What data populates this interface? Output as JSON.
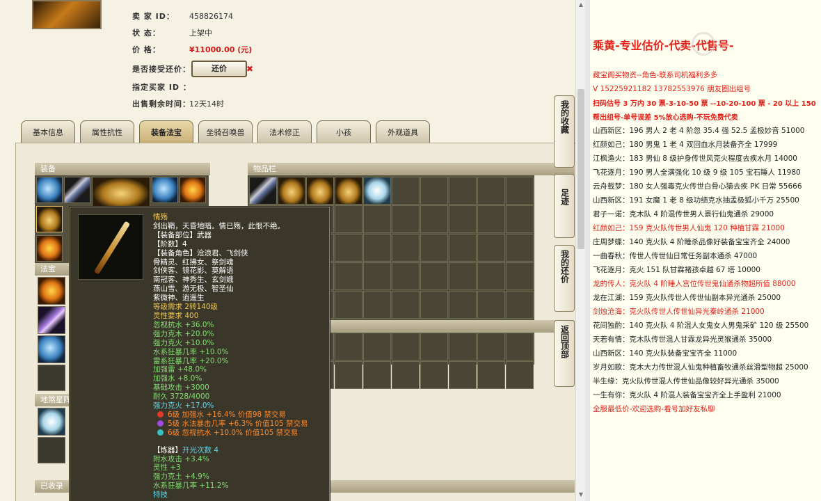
{
  "listing": {
    "seller_label": "卖 家 ID：",
    "seller_id": "458826174",
    "status_label": "状 态：",
    "status_value": "上架中",
    "price_label": "价 格：",
    "price_value": "¥11000.00 (元)",
    "counter_label": "是否接受还价：",
    "counter_button": "还价",
    "counter_close": "✖",
    "buyer_label": "指定买家 ID ：",
    "buyer_value": "",
    "remaining_label": "出售剩余时间：",
    "remaining_value": "12天14时"
  },
  "tabs": [
    "基本信息",
    "属性抗性",
    "装备法宝",
    "坐骑召唤兽",
    "法术修正",
    "小孩",
    "外观道具"
  ],
  "active_tab": 2,
  "panels": {
    "equip": "装备",
    "fabao": "法宝",
    "items": "物品栏",
    "lower_left": "地煞星阵",
    "collected": "已收录"
  },
  "side_buttons": [
    "我的收藏",
    "足迹",
    "我的还价",
    "返回顶部"
  ],
  "tooltip": {
    "name": "情殇",
    "desc": "剑出鞘，天昏地暗。情已殇，此恨不绝。",
    "slot": "【装备部位】武器",
    "tier": "【阶数】4",
    "roles_label": "【装备角色】",
    "roles": [
      "沧浪君、飞剑侠",
      "骨精灵、红拂女、祭剑魂",
      "剑侠客、镜花影、莫解语",
      "南冠客、神秀生、玄剑娥",
      "燕山雪、游无极、智圣仙",
      "紫微神、逍遥生"
    ],
    "level_req": "等级需求 2转140级",
    "spirit_req": "灵性要求 400",
    "stats": [
      "忽视抗水 +36.0%",
      "强力克木 +20.0%",
      "强力克火 +10.0%",
      "水系狂暴几率 +10.0%",
      "雷系狂暴几率 +20.0%",
      "加强雷 +48.0%",
      "加强水 +8.0%",
      "基础攻击 +3000",
      "耐久 3728/4000"
    ],
    "bonus": "强力克火 +17.0%",
    "gems": [
      {
        "text": "6级 加强水 +16.4% 价值98 禁交易",
        "color": "#e23a2a"
      },
      {
        "text": "5级 水法暴击几率 +6.3% 价值105 禁交易",
        "color": "#a04ae0"
      },
      {
        "text": "6级 忽视抗水 +10.0% 价值105 禁交易",
        "color": "#3ac0c0"
      }
    ],
    "refine_label": "【炼器】",
    "refine_count": "开光次数 4",
    "refine_stats": [
      "附水攻击 +3.4%",
      "灵性 +3",
      "强力克土 +4.9%",
      "水系狂暴几率 +11.2%"
    ],
    "last_line": "特技"
  },
  "notes": {
    "title": "乘黄-专业估价-代卖-代售号-",
    "watermark": "",
    "lines": [
      {
        "t": "藏宝阁买物资--角色-联系司机福利多多",
        "c": "note-red"
      },
      {
        "t": "V 15225921182   13782553976 朋友圈出组号",
        "c": "note-red"
      },
      {
        "t": "扫码估号 3 万内 30 票-3-10-50 票 --10-20-100 票 - 20 以上 150",
        "c": "note-bold-red"
      },
      {
        "t": "帮出组号-单号误差 5%放心选购-不玩免费代卖",
        "c": "note-bold-red"
      },
      {
        "t": "山西新区：196 男人 2 老 4 阶忽 35.4 强 52.5 孟极妙音 51000",
        "c": ""
      },
      {
        "t": "红颜如己：180 男鬼 1 老 4 双回血水月装备齐全 17999",
        "c": ""
      },
      {
        "t": "江枫渔火：183 男仙 8 级护身传世风克火程度去疾水月 14000",
        "c": ""
      },
      {
        "t": "飞花逐月：190 男人全满强化 10 级 9 级 105 宝石睡人 11980",
        "c": ""
      },
      {
        "t": "云舟载梦：180 女人强毒克火传世白骨心猿去疾 PK 日常 55666",
        "c": ""
      },
      {
        "t": "山西新区：191 女魔 1 老 8 级功绩克水抽孟极狐小千万 25500",
        "c": ""
      },
      {
        "t": "君子一诺：克木队 4 阶混传世男人景行仙鬼通杀 29000",
        "c": ""
      },
      {
        "t": "红颜如己：159 克火队传世男人仙鬼 120 种植甘霖 21000",
        "c": "note-red"
      },
      {
        "t": "庄周梦蝶：140 克火队 4 阶睡杀品像好装备宝宝齐全 24000",
        "c": ""
      },
      {
        "t": "一曲春秋：传世人传世仙日常任务副本通杀 47000",
        "c": ""
      },
      {
        "t": "飞花逐月：克火 151 队甘霖褚孩卓越 67 塔 10000",
        "c": ""
      },
      {
        "t": "龙的传人：克火队 4 阶睡人宫位传世鬼仙通杀物超所值 88000",
        "c": "note-red"
      },
      {
        "t": "龙在江湖：159 克火队传世人传世仙副本异光通杀 25000",
        "c": ""
      },
      {
        "t": "剑烛沧海：克火队传世人传世仙异光秦岭通杀 21000",
        "c": "note-red"
      },
      {
        "t": "花间独酌：140 克火队 4 阶混人女鬼女人男鬼采矿 120 级 25500",
        "c": ""
      },
      {
        "t": "天若有情：克木队传世混人甘霖龙异光灵猴通杀 35000",
        "c": ""
      },
      {
        "t": "山西新区：140 克火队装备宝宝齐全 11000",
        "c": ""
      },
      {
        "t": "岁月如歌：克木大力传世混人仙鬼种植畜牧通杀丝滑型物超 25000",
        "c": ""
      },
      {
        "t": "半生缘：克火队传世混人传世仙品像较好异光通杀 35000",
        "c": ""
      },
      {
        "t": "一生有你：克火队 4 阶混人装备宝宝齐全上手盈利 21000",
        "c": ""
      },
      {
        "t": "全服最低价-欢迎选购-看号加好友私聊",
        "c": "note-red"
      }
    ]
  }
}
